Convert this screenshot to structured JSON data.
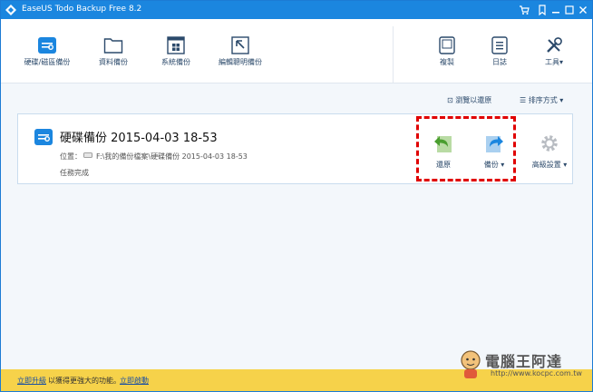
{
  "app": {
    "title": "EaseUS Todo Backup Free 8.2",
    "accent_color": "#1b86df"
  },
  "titlebar_icons": [
    "cart-icon",
    "bookmark-icon",
    "minimize-icon",
    "restore-icon",
    "close-icon"
  ],
  "toolbar": {
    "left_items": [
      {
        "label": "硬碟/磁區備份",
        "icon": "disk-backup-icon"
      },
      {
        "label": "資料備份",
        "icon": "folder-icon"
      },
      {
        "label": "系統備份",
        "icon": "windows-icon"
      },
      {
        "label": "編輯聰明備份",
        "icon": "smart-backup-icon"
      }
    ],
    "right_items": [
      {
        "label": "複製",
        "icon": "clone-icon"
      },
      {
        "label": "日誌",
        "icon": "log-icon"
      },
      {
        "label": "工具",
        "icon": "tools-icon"
      }
    ]
  },
  "sortbar": {
    "browse_label": "瀏覽以還原",
    "sort_label": "排序方式"
  },
  "backup_card": {
    "name": "硬碟備份 2015-04-03 18-53",
    "location_label": "位置：",
    "path": "F:\\我的備份檔案\\硬碟備份 2015-04-03 18-53",
    "status": "任務完成",
    "actions": {
      "restore_label": "還原",
      "backup_label": "備份",
      "advanced_label": "高級設置"
    }
  },
  "bottombar": {
    "upgrade_link": "立即升級",
    "upgrade_text": "以獲得更強大的功能。",
    "activate_link": "立即啟動"
  },
  "watermark": {
    "title": "電腦王阿達",
    "url": "http://www.kocpc.com.tw"
  }
}
